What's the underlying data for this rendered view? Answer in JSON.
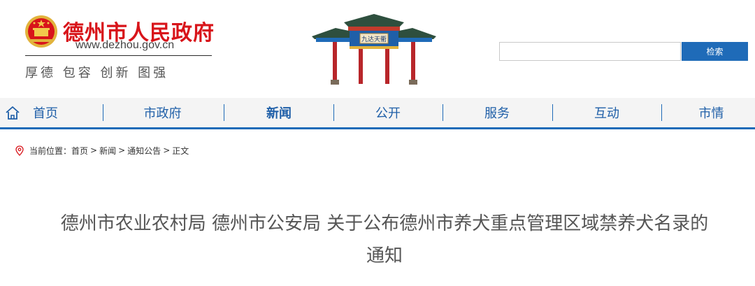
{
  "header": {
    "site_name": "德州市人民政府",
    "site_url": "www.dezhou.gov.cn",
    "slogan": "厚德 包容 创新 图强",
    "gate_plaque": "九达天衢"
  },
  "search": {
    "placeholder": "",
    "button_label": "检索"
  },
  "nav": {
    "items": [
      {
        "label": "首页"
      },
      {
        "label": "市政府"
      },
      {
        "label": "新闻"
      },
      {
        "label": "公开"
      },
      {
        "label": "服务"
      },
      {
        "label": "互动"
      },
      {
        "label": "市情"
      }
    ],
    "active_index": 2
  },
  "breadcrumb": {
    "prefix": "当前位置：",
    "items": [
      "首页",
      "新闻",
      "通知公告",
      "正文"
    ],
    "separator": ">"
  },
  "article": {
    "title_line1": "德州市农业农村局 德州市公安局 关于公布德州市养犬重点管理区域禁养犬名录的",
    "title_line2": "通知"
  },
  "colors": {
    "brand_red": "#d8141a",
    "nav_blue": "#1f6bb8",
    "nav_bg": "#f4f4f4"
  },
  "icons": {
    "home": "home-icon",
    "location": "location-pin-icon",
    "emblem": "national-emblem-icon"
  }
}
